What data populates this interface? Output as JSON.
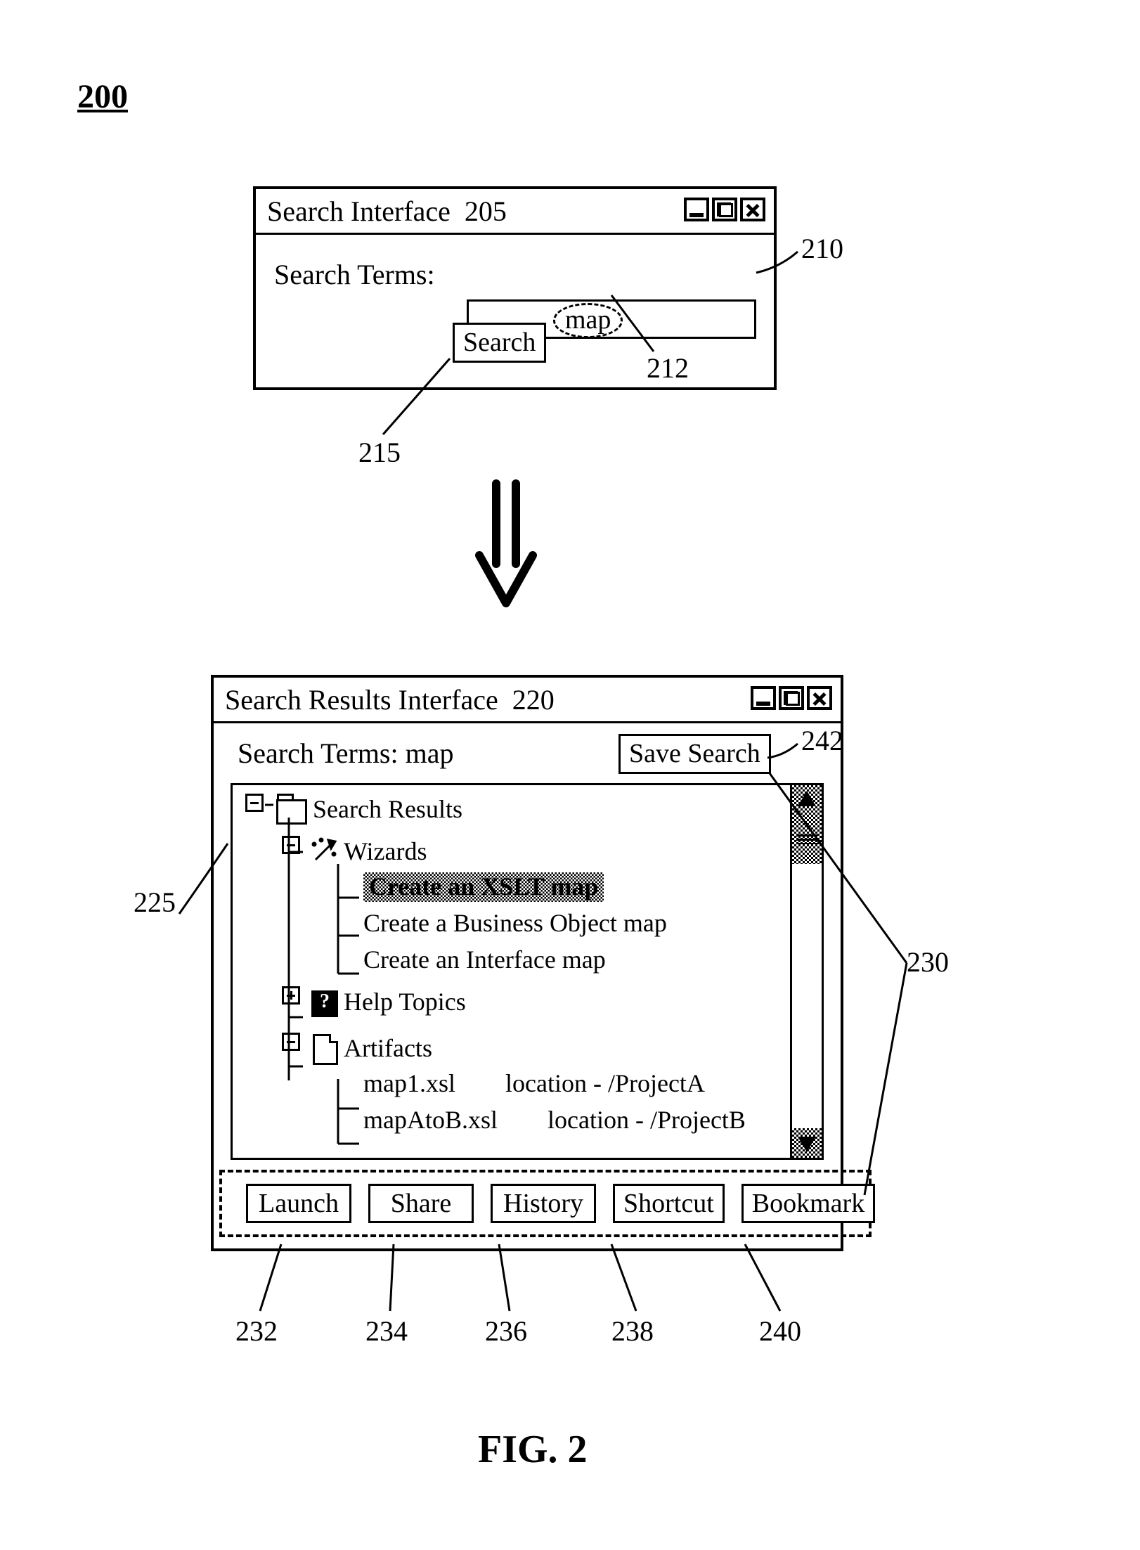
{
  "figure": {
    "number_label": "200",
    "caption": "FIG. 2"
  },
  "callouts": {
    "c205": "205",
    "c210": "210",
    "c212": "212",
    "c215": "215",
    "c220": "220",
    "c225": "225",
    "c230": "230",
    "c232": "232",
    "c234": "234",
    "c236": "236",
    "c238": "238",
    "c240": "240",
    "c242": "242"
  },
  "search_window": {
    "title": "Search Interface",
    "terms_label": "Search Terms:",
    "input_value": "map",
    "search_button": "Search"
  },
  "results_window": {
    "title": "Search Results Interface",
    "terms_label": "Search Terms: map",
    "save_button": "Save Search",
    "tree": {
      "root": "Search Results",
      "wizards": {
        "label": "Wizards",
        "items": [
          "Create an XSLT map",
          "Create a Business Object map",
          "Create an Interface map"
        ],
        "selected_index": 0
      },
      "help": {
        "label": "Help Topics"
      },
      "artifacts": {
        "label": "Artifacts",
        "items": [
          {
            "name": "map1.xsl",
            "location": "location - /ProjectA"
          },
          {
            "name": "mapAtoB.xsl",
            "location": "location - /ProjectB"
          }
        ]
      }
    },
    "toolbar": {
      "launch": "Launch",
      "share": "Share",
      "history": "History",
      "shortcut": "Shortcut",
      "bookmark": "Bookmark"
    }
  }
}
